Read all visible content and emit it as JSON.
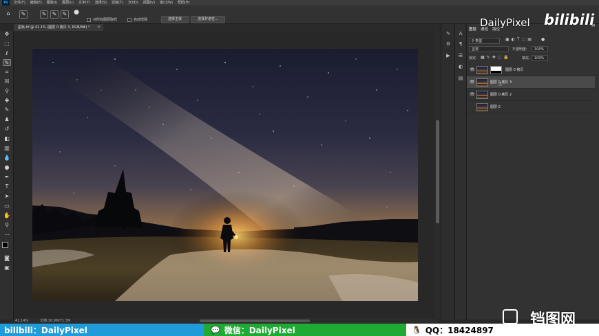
{
  "menu": {
    "items": [
      "文件(F)",
      "编辑(E)",
      "图像(I)",
      "图层(L)",
      "文字(Y)",
      "选择(S)",
      "滤镜(T)",
      "3D(D)",
      "视图(V)",
      "窗口(W)",
      "帮助(H)"
    ]
  },
  "options_bar": {
    "sample_all_layers": "对所有图层取样",
    "auto_enhance": "自动增强",
    "select_subject": "选择主体",
    "select_and_mask": "选择并遮住..."
  },
  "document_tab": {
    "title": "星轨.tif @ 41.1% (图层 0 拷贝 3, RGB/8#) *",
    "close": "×"
  },
  "status": {
    "zoom": "41.14%",
    "doc_size": "文档:16.9M/71.3M"
  },
  "layers_panel": {
    "tabs": [
      "图层",
      "通道",
      "路径"
    ],
    "filter_kind": "类型",
    "blend_mode": "正常",
    "opacity_label": "不透明度:",
    "opacity_value": "100%",
    "lock_label": "锁定:",
    "fill_label": "填充:",
    "fill_value": "100%",
    "layers": [
      {
        "name": "图层 0 拷贝",
        "visible": true,
        "has_mask": true,
        "selected": false
      },
      {
        "name": "图层 0 拷贝 3",
        "visible": true,
        "has_mask": false,
        "selected": true
      },
      {
        "name": "图层 0 拷贝 2",
        "visible": true,
        "has_mask": false,
        "selected": false
      },
      {
        "name": "图层 0",
        "visible": false,
        "has_mask": false,
        "selected": false
      }
    ]
  },
  "watermark": {
    "channel": "DailyPixel",
    "platform": "bilibili"
  },
  "promo": {
    "bilibili": "bilibili：DailyPixel",
    "wechat": "微信：DailyPixel",
    "qq": "QQ：18424897",
    "site": "铛图网"
  },
  "colors": {
    "bili_blue": "#1e9bd8",
    "wechat_green": "#1faa34",
    "ps_dark": "#282828"
  }
}
